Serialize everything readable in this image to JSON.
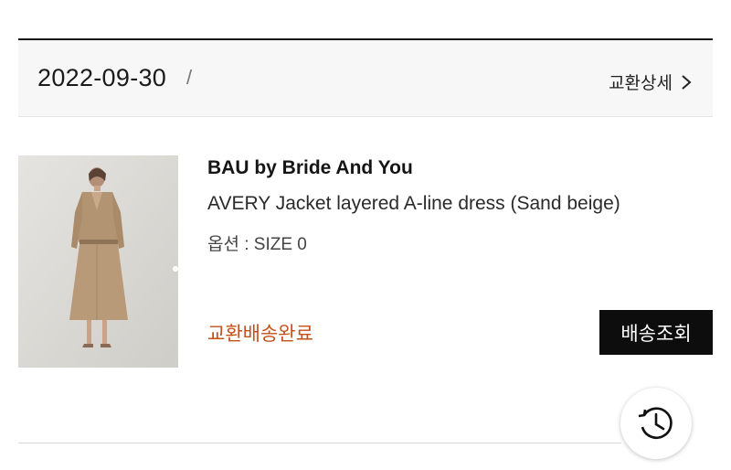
{
  "order": {
    "date": "2022-09-30",
    "separator": "/",
    "detail_link": "교환상세"
  },
  "product": {
    "brand": "BAU by Bride And You",
    "name": "AVERY Jacket layered A-line dress (Sand beige)",
    "option": "옵션 : SIZE 0",
    "image_icon": "product-photo-beige-dress"
  },
  "status": {
    "label": "교환배송완료",
    "color": "#c4501a"
  },
  "actions": {
    "track_label": "배송조회"
  },
  "fab": {
    "icon": "history-clock-icon"
  }
}
